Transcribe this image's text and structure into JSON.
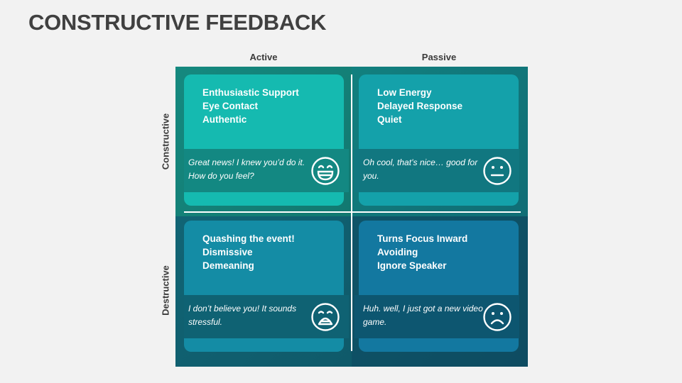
{
  "title": "CONSTRUCTIVE FEEDBACK",
  "columns": [
    "Active",
    "Passive"
  ],
  "rows": [
    "Constructive",
    "Destructive"
  ],
  "colors": {
    "q1_bg": "#14877e",
    "q1_card": "#15bab0",
    "q1_band": "#138882",
    "q2_bg": "#127880",
    "q2_card": "#14a1aa",
    "q2_band": "#117780",
    "q3_bg": "#116070",
    "q3_card": "#148ca5",
    "q3_band": "#0f6273",
    "q4_bg": "#0f5166",
    "q4_card": "#1378a0",
    "q4_band": "#0d5670",
    "title_text": "#404040",
    "divider": "#ffffff"
  },
  "quadrants": [
    {
      "column": "Active",
      "row": "Constructive",
      "points": [
        "Enthusiastic Support",
        "Eye Contact",
        "Authentic"
      ],
      "quote": "Great news! I knew you’d do it. How do you feel?",
      "icon": "laughing-face-icon"
    },
    {
      "column": "Passive",
      "row": "Constructive",
      "points": [
        "Low Energy",
        "Delayed Response",
        "Quiet"
      ],
      "quote": "Oh cool, that’s nice… good for you.",
      "icon": "neutral-face-icon"
    },
    {
      "column": "Active",
      "row": "Destructive",
      "points": [
        "Quashing the event!",
        "Dismissive",
        "Demeaning"
      ],
      "quote": "I don’t believe you! It sounds stressful.",
      "icon": "distressed-face-icon"
    },
    {
      "column": "Passive",
      "row": "Destructive",
      "points": [
        "Turns Focus Inward",
        "Avoiding",
        "Ignore Speaker"
      ],
      "quote": "Huh. well, I just got a new video game.",
      "icon": "sad-face-icon"
    }
  ]
}
